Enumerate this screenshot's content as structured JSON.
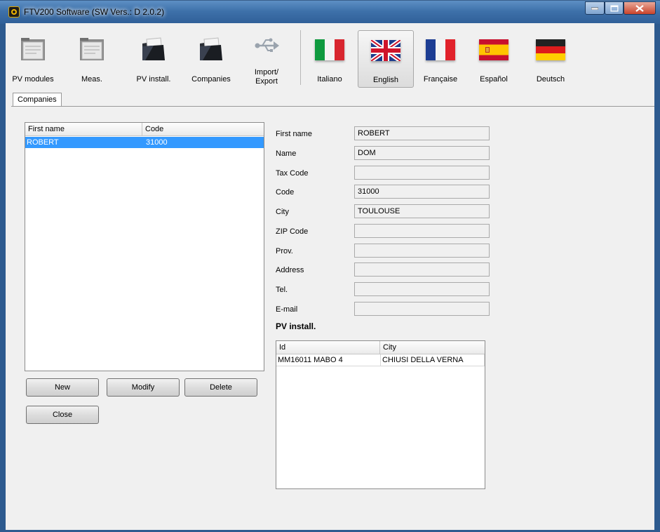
{
  "window": {
    "title": "FTV200 Software (SW Vers.: D 2.0.2)"
  },
  "toolbar": {
    "items": [
      {
        "label": "PV modules",
        "icon": "pv-modules-folder-icon"
      },
      {
        "label": "Meas.",
        "icon": "measurements-folder-icon"
      },
      {
        "label": "PV install.",
        "icon": "pv-install-folder-icon"
      },
      {
        "label": "Companies",
        "icon": "companies-folder-icon"
      },
      {
        "label_line1": "Import/",
        "label_line2": "Export",
        "icon": "usb-icon"
      },
      {
        "label": "Italiano",
        "icon": "italy-flag-icon"
      },
      {
        "label": "English",
        "icon": "uk-flag-icon",
        "active": true
      },
      {
        "label": "Française",
        "icon": "france-flag-icon"
      },
      {
        "label": "Español",
        "icon": "spain-flag-icon"
      },
      {
        "label": "Deutsch",
        "icon": "germany-flag-icon"
      }
    ]
  },
  "tabs": [
    {
      "label": "Companies",
      "selected": true
    }
  ],
  "company_list": {
    "columns": [
      "First name",
      "Code"
    ],
    "rows": [
      {
        "first_name": "ROBERT",
        "code": "31000",
        "selected": true
      }
    ]
  },
  "details": {
    "first_name": {
      "label": "First name",
      "value": "ROBERT"
    },
    "name": {
      "label": "Name",
      "value": "DOM"
    },
    "tax_code": {
      "label": "Tax Code",
      "value": ""
    },
    "code": {
      "label": "Code",
      "value": "31000"
    },
    "city": {
      "label": "City",
      "value": "TOULOUSE"
    },
    "zip": {
      "label": "ZIP Code",
      "value": ""
    },
    "prov": {
      "label": "Prov.",
      "value": ""
    },
    "address": {
      "label": "Address",
      "value": ""
    },
    "tel": {
      "label": "Tel.",
      "value": ""
    },
    "email": {
      "label": "E-mail",
      "value": ""
    }
  },
  "pv_install": {
    "title": "PV install.",
    "columns": [
      "Id",
      "City"
    ],
    "rows": [
      {
        "id": "MM16011 MABO 4",
        "city": "CHIUSI DELLA VERNA"
      }
    ]
  },
  "buttons": {
    "new": "New",
    "modify": "Modify",
    "delete": "Delete",
    "close": "Close"
  },
  "colors": {
    "selection": "#3399ff",
    "titlebar": "#3e71aa"
  }
}
